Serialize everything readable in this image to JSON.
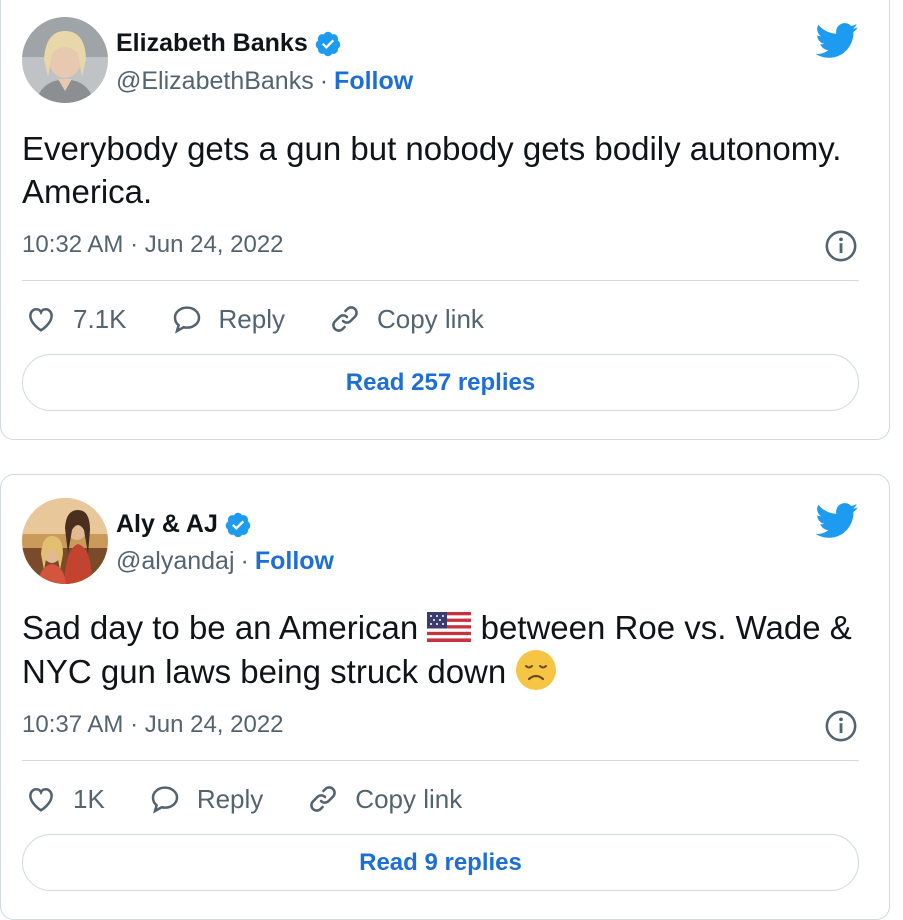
{
  "tweets": [
    {
      "name": "Elizabeth Banks",
      "handle": "@ElizabethBanks",
      "separator": "·",
      "follow_label": "Follow",
      "text": "Everybody gets a gun but nobody gets bodily autonomy. America.",
      "time": "10:32 AM · Jun 24, 2022",
      "likes": "7.1K",
      "reply_label": "Reply",
      "copy_label": "Copy link",
      "read_label": "Read 257 replies"
    },
    {
      "name": "Aly & AJ",
      "handle": "@alyandaj",
      "separator": "·",
      "follow_label": "Follow",
      "text_part1": "Sad day to be an American ",
      "text_part2": " between Roe vs. Wade & NYC gun laws being struck down ",
      "time": "10:37 AM · Jun 24, 2022",
      "likes": "1K",
      "reply_label": "Reply",
      "copy_label": "Copy link",
      "read_label": "Read 9 replies"
    }
  ],
  "icons": {
    "verified": "verified-badge-icon",
    "bird": "twitter-bird-icon",
    "info": "info-icon",
    "heart": "heart-icon",
    "reply": "reply-bubble-icon",
    "link": "link-icon",
    "flag": "us-flag-emoji",
    "disappointed": "disappointed-face-emoji"
  },
  "colors": {
    "accent": "#1d9bf0",
    "link_text": "#1d6fd6",
    "secondary_text": "#536471",
    "border": "#cfd9de"
  }
}
